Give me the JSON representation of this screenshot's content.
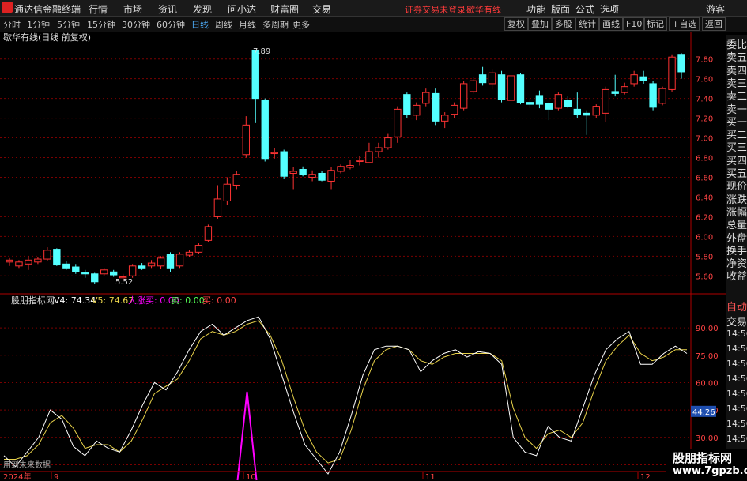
{
  "app": {
    "name": "通达信金融终端",
    "notice": "证券交易未登录",
    "stock_name": "歇华有线"
  },
  "menu": [
    "行情",
    "市场",
    "资讯",
    "发现",
    "问小达",
    "财富圈",
    "交易"
  ],
  "menu_right": [
    "功能",
    "版面",
    "公式",
    "选项",
    "游客"
  ],
  "periods": [
    "分时",
    "1分钟",
    "5分钟",
    "15分钟",
    "30分钟",
    "60分钟",
    "日线",
    "周线",
    "月线",
    "多周期",
    "更多"
  ],
  "active_period": "日线",
  "toolbar_right": [
    "复权",
    "叠加",
    "多股",
    "统计",
    "画线",
    "F10",
    "标记",
    "+自选",
    "返回"
  ],
  "main_title": "歇华有线(日线 前复权)",
  "price_axis": [
    "7.80",
    "7.60",
    "7.40",
    "7.20",
    "7.00",
    "6.80",
    "6.60",
    "6.40",
    "6.20",
    "6.00",
    "5.80",
    "5.60"
  ],
  "high_label": "7.89",
  "low_label": "5.52",
  "indicator": {
    "name": "股朋指标网",
    "v4_label": "V4: 74.34",
    "v5_label": "V5: 74.67",
    "big_rise_label": "大涨买: 0.00",
    "sell_label": "卖: 0.00",
    "buy_label": "买: 0.00",
    "axis": [
      "90.00",
      "75.00",
      "60.00",
      "45.00",
      "30.00",
      "15.00"
    ],
    "current_tag": "44.26",
    "footer_note": "用到未来数据"
  },
  "date_axis": [
    "2024年",
    "9",
    "10",
    "11",
    "12"
  ],
  "side_labels": [
    "委比",
    "卖五",
    "卖四",
    "卖三",
    "卖二",
    "卖一",
    "买一",
    "买二",
    "买三",
    "买四",
    "买五",
    "现价",
    "涨跌",
    "涨幅",
    "总量",
    "外盘",
    "换手",
    "净资",
    "收益"
  ],
  "side_lower": [
    "自动",
    "交易",
    "14:56",
    "14:56",
    "14:56",
    "14:56",
    "14:56",
    "14:56",
    "14:56",
    "14:56",
    "14:56"
  ],
  "watermark": {
    "line1": "股朋指标网",
    "line2": "www.7gpzb.com"
  },
  "colors": {
    "up": "#ff3333",
    "down": "#54ffff",
    "v4": "#ffffff",
    "v5": "#e8d24a",
    "pulse": "#ff00ff",
    "grid": "#7a0000",
    "axis_text": "#ff4444"
  },
  "chart_data": {
    "type": "candlestick",
    "price_range": [
      5.45,
      7.95
    ],
    "candles": [
      {
        "o": 5.74,
        "c": 5.76,
        "h": 5.78,
        "l": 5.7
      },
      {
        "o": 5.7,
        "c": 5.74,
        "h": 5.76,
        "l": 5.68
      },
      {
        "o": 5.72,
        "c": 5.76,
        "h": 5.8,
        "l": 5.66
      },
      {
        "o": 5.74,
        "c": 5.77,
        "h": 5.79,
        "l": 5.72
      },
      {
        "o": 5.77,
        "c": 5.86,
        "h": 5.89,
        "l": 5.75
      },
      {
        "o": 5.87,
        "c": 5.71,
        "h": 5.88,
        "l": 5.7
      },
      {
        "o": 5.72,
        "c": 5.68,
        "h": 5.75,
        "l": 5.66
      },
      {
        "o": 5.69,
        "c": 5.64,
        "h": 5.72,
        "l": 5.62
      },
      {
        "o": 5.63,
        "c": 5.62,
        "h": 5.66,
        "l": 5.58
      },
      {
        "o": 5.62,
        "c": 5.54,
        "h": 5.63,
        "l": 5.52
      },
      {
        "o": 5.62,
        "c": 5.66,
        "h": 5.68,
        "l": 5.6
      },
      {
        "o": 5.64,
        "c": 5.61,
        "h": 5.66,
        "l": 5.59
      },
      {
        "o": 5.58,
        "c": 5.59,
        "h": 5.62,
        "l": 5.55
      },
      {
        "o": 5.6,
        "c": 5.7,
        "h": 5.72,
        "l": 5.58
      },
      {
        "o": 5.7,
        "c": 5.68,
        "h": 5.73,
        "l": 5.66
      },
      {
        "o": 5.7,
        "c": 5.73,
        "h": 5.76,
        "l": 5.68
      },
      {
        "o": 5.7,
        "c": 5.78,
        "h": 5.8,
        "l": 5.67
      },
      {
        "o": 5.82,
        "c": 5.68,
        "h": 5.84,
        "l": 5.64
      },
      {
        "o": 5.7,
        "c": 5.82,
        "h": 5.84,
        "l": 5.68
      },
      {
        "o": 5.81,
        "c": 5.84,
        "h": 5.86,
        "l": 5.79
      },
      {
        "o": 5.84,
        "c": 5.91,
        "h": 5.93,
        "l": 5.82
      },
      {
        "o": 5.96,
        "c": 6.1,
        "h": 6.12,
        "l": 5.94
      },
      {
        "o": 6.2,
        "c": 6.38,
        "h": 6.52,
        "l": 6.18
      },
      {
        "o": 6.36,
        "c": 6.53,
        "h": 6.6,
        "l": 6.32
      },
      {
        "o": 6.52,
        "c": 6.63,
        "h": 6.66,
        "l": 6.48
      },
      {
        "o": 6.83,
        "c": 7.13,
        "h": 7.22,
        "l": 6.8
      },
      {
        "o": 7.89,
        "c": 7.4,
        "h": 7.89,
        "l": 7.15
      },
      {
        "o": 7.38,
        "c": 6.79,
        "h": 7.4,
        "l": 6.76
      },
      {
        "o": 6.84,
        "c": 6.85,
        "h": 6.9,
        "l": 6.79
      },
      {
        "o": 6.86,
        "c": 6.61,
        "h": 6.88,
        "l": 6.58
      },
      {
        "o": 6.64,
        "c": 6.66,
        "h": 6.7,
        "l": 6.48
      },
      {
        "o": 6.68,
        "c": 6.63,
        "h": 6.71,
        "l": 6.61
      },
      {
        "o": 6.6,
        "c": 6.63,
        "h": 6.67,
        "l": 6.56
      },
      {
        "o": 6.64,
        "c": 6.57,
        "h": 6.66,
        "l": 6.56
      },
      {
        "o": 6.56,
        "c": 6.67,
        "h": 6.7,
        "l": 6.48
      },
      {
        "o": 6.66,
        "c": 6.71,
        "h": 6.73,
        "l": 6.64
      },
      {
        "o": 6.7,
        "c": 6.72,
        "h": 6.78,
        "l": 6.68
      },
      {
        "o": 6.76,
        "c": 6.77,
        "h": 6.82,
        "l": 6.72
      },
      {
        "o": 6.75,
        "c": 6.86,
        "h": 6.95,
        "l": 6.74
      },
      {
        "o": 6.86,
        "c": 6.9,
        "h": 6.95,
        "l": 6.8
      },
      {
        "o": 6.9,
        "c": 7.0,
        "h": 7.04,
        "l": 6.88
      },
      {
        "o": 7.01,
        "c": 7.29,
        "h": 7.32,
        "l": 6.95
      },
      {
        "o": 7.44,
        "c": 7.24,
        "h": 7.46,
        "l": 7.2
      },
      {
        "o": 7.23,
        "c": 7.33,
        "h": 7.36,
        "l": 7.18
      },
      {
        "o": 7.35,
        "c": 7.46,
        "h": 7.5,
        "l": 7.32
      },
      {
        "o": 7.45,
        "c": 7.17,
        "h": 7.5,
        "l": 7.13
      },
      {
        "o": 7.17,
        "c": 7.23,
        "h": 7.26,
        "l": 7.1
      },
      {
        "o": 7.24,
        "c": 7.33,
        "h": 7.36,
        "l": 7.2
      },
      {
        "o": 7.3,
        "c": 7.55,
        "h": 7.58,
        "l": 7.28
      },
      {
        "o": 7.47,
        "c": 7.58,
        "h": 7.62,
        "l": 7.45
      },
      {
        "o": 7.64,
        "c": 7.56,
        "h": 7.72,
        "l": 7.53
      },
      {
        "o": 7.55,
        "c": 7.66,
        "h": 7.7,
        "l": 7.49
      },
      {
        "o": 7.64,
        "c": 7.39,
        "h": 7.68,
        "l": 7.36
      },
      {
        "o": 7.38,
        "c": 7.63,
        "h": 7.66,
        "l": 7.35
      },
      {
        "o": 7.64,
        "c": 7.36,
        "h": 7.66,
        "l": 7.34
      },
      {
        "o": 7.36,
        "c": 7.34,
        "h": 7.4,
        "l": 7.3
      },
      {
        "o": 7.43,
        "c": 7.34,
        "h": 7.48,
        "l": 7.3
      },
      {
        "o": 7.35,
        "c": 7.29,
        "h": 7.36,
        "l": 7.18
      },
      {
        "o": 7.3,
        "c": 7.44,
        "h": 7.46,
        "l": 7.28
      },
      {
        "o": 7.38,
        "c": 7.32,
        "h": 7.42,
        "l": 7.3
      },
      {
        "o": 7.29,
        "c": 7.24,
        "h": 7.46,
        "l": 7.2
      },
      {
        "o": 7.25,
        "c": 7.23,
        "h": 7.28,
        "l": 7.03
      },
      {
        "o": 7.23,
        "c": 7.32,
        "h": 7.34,
        "l": 7.2
      },
      {
        "o": 7.25,
        "c": 7.49,
        "h": 7.52,
        "l": 7.16
      },
      {
        "o": 7.47,
        "c": 7.45,
        "h": 7.64,
        "l": 7.42
      },
      {
        "o": 7.46,
        "c": 7.52,
        "h": 7.56,
        "l": 7.44
      },
      {
        "o": 7.55,
        "c": 7.64,
        "h": 7.68,
        "l": 7.52
      },
      {
        "o": 7.62,
        "c": 7.58,
        "h": 7.68,
        "l": 7.55
      },
      {
        "o": 7.55,
        "c": 7.31,
        "h": 7.58,
        "l": 7.28
      },
      {
        "o": 7.35,
        "c": 7.5,
        "h": 7.52,
        "l": 7.33
      },
      {
        "o": 7.49,
        "c": 7.82,
        "h": 7.84,
        "l": 7.47
      },
      {
        "o": 7.84,
        "c": 7.67,
        "h": 7.86,
        "l": 7.6
      }
    ],
    "indicator_range": [
      10,
      100
    ],
    "v4": [
      20,
      14,
      22,
      30,
      45,
      40,
      25,
      20,
      28,
      24,
      22,
      34,
      48,
      60,
      56,
      66,
      78,
      88,
      92,
      86,
      90,
      94,
      96,
      84,
      64,
      44,
      26,
      18,
      10,
      22,
      42,
      64,
      78,
      80,
      80,
      78,
      66,
      72,
      76,
      78,
      74,
      77,
      76,
      70,
      30,
      22,
      20,
      36,
      30,
      28,
      46,
      64,
      78,
      84,
      88,
      70,
      70,
      76,
      80,
      76
    ],
    "v5": [
      18,
      18,
      20,
      26,
      38,
      42,
      35,
      24,
      26,
      26,
      22,
      28,
      40,
      54,
      58,
      62,
      72,
      84,
      88,
      86,
      88,
      92,
      94,
      86,
      72,
      52,
      34,
      22,
      16,
      18,
      34,
      56,
      72,
      78,
      80,
      78,
      72,
      70,
      74,
      76,
      76,
      76,
      76,
      72,
      46,
      30,
      24,
      32,
      34,
      30,
      38,
      56,
      72,
      80,
      86,
      76,
      72,
      74,
      78,
      78
    ],
    "pulse_index": 21,
    "pulse_value": 55
  }
}
